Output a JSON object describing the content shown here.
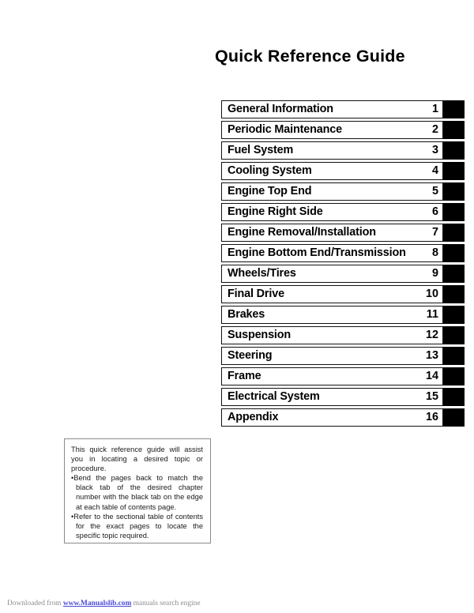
{
  "document": {
    "title": "Quick Reference Guide"
  },
  "chapters": [
    {
      "label": "General Information",
      "number": "1"
    },
    {
      "label": "Periodic Maintenance",
      "number": "2"
    },
    {
      "label": "Fuel System",
      "number": "3"
    },
    {
      "label": "Cooling System",
      "number": "4"
    },
    {
      "label": "Engine Top End",
      "number": "5"
    },
    {
      "label": "Engine Right Side",
      "number": "6"
    },
    {
      "label": "Engine Removal/Installation",
      "number": "7"
    },
    {
      "label": "Engine Bottom End/Transmission",
      "number": "8"
    },
    {
      "label": "Wheels/Tires",
      "number": "9"
    },
    {
      "label": "Final Drive",
      "number": "10"
    },
    {
      "label": "Brakes",
      "number": "11"
    },
    {
      "label": "Suspension",
      "number": "12"
    },
    {
      "label": "Steering",
      "number": "13"
    },
    {
      "label": "Frame",
      "number": "14"
    },
    {
      "label": "Electrical System",
      "number": "15"
    },
    {
      "label": "Appendix",
      "number": "16"
    }
  ],
  "note": {
    "intro": "This quick reference guide will assist you in locating a desired topic or procedure.",
    "bullets": [
      "Bend the pages back to match the black tab of the desired chapter number with the black tab on the edge at each table of contents page.",
      "Refer to the sectional table of contents for the exact pages to locate the specific topic required."
    ],
    "bullet_marker": "•"
  },
  "footer": {
    "prefix": "Downloaded from ",
    "link": "www.Manualslib.com",
    "suffix": " manuals search engine"
  },
  "colors": {
    "tab_black": "#000000",
    "row_border": "#121212",
    "note_border": "#8a8a8a",
    "footer_text": "#8d8d8d",
    "footer_link": "#4a4ad8"
  }
}
